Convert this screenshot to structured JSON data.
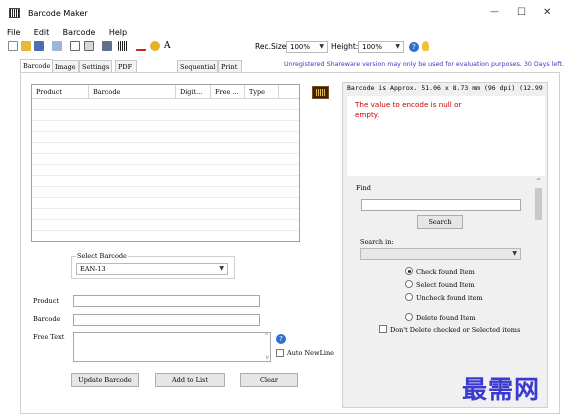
{
  "window": {
    "title": "Barcode Maker"
  },
  "window_controls": {
    "minimize": "—",
    "maximize": "☐",
    "close": "✕"
  },
  "menu": [
    "File",
    "Edit",
    "Barcode",
    "Help"
  ],
  "toolbar": {
    "font_name": "宋体",
    "rec_size_label": "Rec.Size",
    "rec_size_value": "100%",
    "height_label": "Height:",
    "height_value": "100%"
  },
  "tabs": [
    "Barcode",
    "Image",
    "Settings",
    "PDF / Zip / EXIF",
    "Sequential",
    "Print on Label"
  ],
  "active_tab": 0,
  "notice": "Unregistered Shareware version may only be used for evaluation purposes. 30 Days left.",
  "grid": {
    "columns": [
      "Product",
      "Barcode",
      "Digit...",
      "Free ...",
      "Type"
    ]
  },
  "select_barcode": {
    "legend": "Select Barcode",
    "value": "EAN-13"
  },
  "form": {
    "product_label": "Product",
    "barcode_label": "Barcode",
    "free_text_label": "Free Text",
    "auto_newline_label": "Auto NewLine"
  },
  "buttons": {
    "update": "Update Barcode",
    "add": "Add to List",
    "clear": "Clear"
  },
  "right_panel": {
    "approx": "Barcode is Approx. 51.06 x 8.73 mm  (96 dpi) (12.99",
    "error": "The value to encode is null or empty.",
    "find_label": "Find",
    "search_button": "Search",
    "search_in_label": "Search in:",
    "options": [
      {
        "label": "Check found Item",
        "selected": true
      },
      {
        "label": "Select found Item",
        "selected": false
      },
      {
        "label": "Uncheck found item",
        "selected": false
      },
      {
        "label": "Delete found Item",
        "selected": false
      }
    ],
    "dont_delete_label": "Don't Delete checked or Selected items"
  },
  "watermark": "最需网",
  "colors": {
    "error": "#cc0000",
    "notice": "#3b3bbf",
    "watermark": "#3a3ad0"
  }
}
